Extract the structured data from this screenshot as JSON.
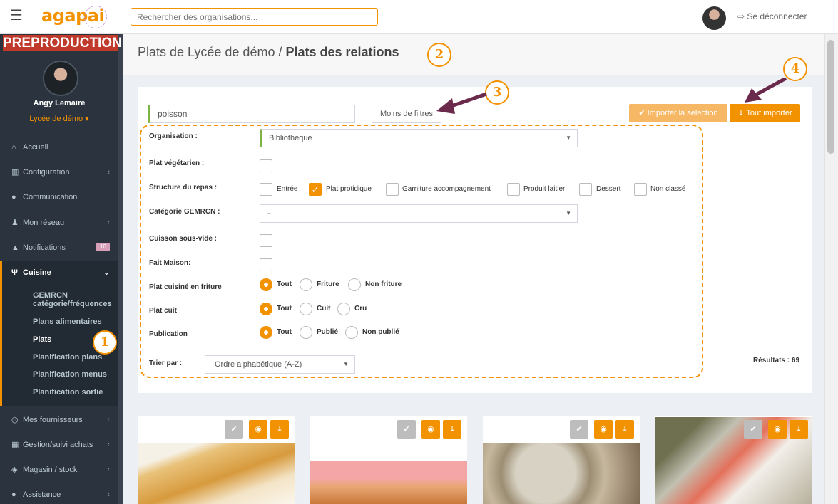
{
  "topbar": {
    "logo": "agapai",
    "search_placeholder": "Rechercher des organisations...",
    "logout": "Se déconnecter"
  },
  "sidebar": {
    "banner": "PREPRODUCTION",
    "user_name": "Angy Lemaire",
    "user_org": "Lycée de démo ▾",
    "items": [
      {
        "icon": "home-icon",
        "label": "Accueil"
      },
      {
        "icon": "bank-icon",
        "label": "Configuration"
      },
      {
        "icon": "comments-icon",
        "label": "Communication"
      },
      {
        "icon": "users-icon",
        "label": "Mon réseau"
      },
      {
        "icon": "bell-icon",
        "label": "Notifications",
        "badge": "10"
      },
      {
        "icon": "cutlery-icon",
        "label": "Cuisine"
      },
      {
        "icon": "handshake-icon",
        "label": "Mes fournisseurs"
      },
      {
        "icon": "cart-icon",
        "label": "Gestion/suivi achats"
      },
      {
        "icon": "cubes-icon",
        "label": "Magasin / stock"
      },
      {
        "icon": "question-icon",
        "label": "Assistance"
      }
    ],
    "cuisine_sub": [
      "GEMRCN",
      "catégorie/fréquences",
      "Plans alimentaires",
      "Plats",
      "Planification plans",
      "Planification menus",
      "Planification sortie"
    ]
  },
  "page": {
    "title_light": "Plats de Lycée de démo / ",
    "title_bold": "Plats des relations"
  },
  "filters": {
    "search_value": "poisson",
    "less_filters": "Moins de filtres",
    "import_selection": "✔ Importer la sélection",
    "import_all": "↧ Tout importer",
    "organisation_label": "Organisation :",
    "organisation_value": "Bibliothèque",
    "vegetarian_label": "Plat végétarien :",
    "structure_label": "Structure du repas :",
    "structure_options": [
      "Entrée",
      "Plat protidique",
      "Garniture accompagnement",
      "Produit laitier",
      "Dessert",
      "Non classé"
    ],
    "structure_checked": "Plat protidique",
    "gemrcn_label": "Catégorie GEMRCN :",
    "gemrcn_value": "-",
    "sousvide_label": "Cuisson sous-vide :",
    "maison_label": "Fait Maison:",
    "friture_label": "Plat cuisiné en friture",
    "friture_options": [
      "Tout",
      "Friture",
      "Non friture"
    ],
    "cuit_label": "Plat cuit",
    "cuit_options": [
      "Tout",
      "Cuit",
      "Cru"
    ],
    "publication_label": "Publication",
    "publication_options": [
      "Tout",
      "Publié",
      "Non publié"
    ],
    "sort_label": "Trier par :",
    "sort_value": "Ordre alphabétique (A-Z)",
    "results": "Résultats : 69"
  },
  "annotations": [
    "1",
    "2",
    "3",
    "4"
  ],
  "colors": {
    "accent": "#f39200",
    "sidebar": "#2b333e",
    "banner": "#c0392b",
    "annotation_arrow": "#6b2a4b"
  }
}
